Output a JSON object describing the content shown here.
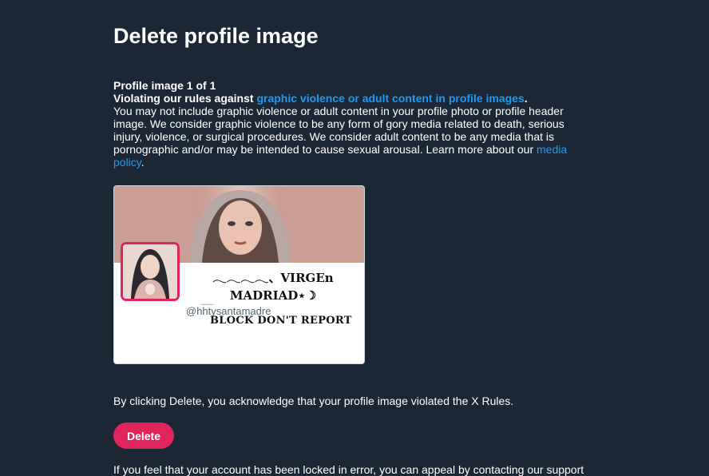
{
  "page": {
    "title": "Delete profile image",
    "count_label": "Profile image 1 of 1"
  },
  "rule": {
    "prefix": "Violating our rules against ",
    "link": "graphic violence or adult content in profile images",
    "suffix": ".",
    "description": "You may not include graphic violence or adult content in your profile photo or profile header image. We consider graphic violence to be any form of gory media related to death, serious injury, violence, or surgical procedures. We consider adult content to be any media that is pornographic and/or may be intended to cause sexual arousal. Learn more about our ",
    "policy_link": "media policy",
    "policy_suffix": "."
  },
  "profile_card": {
    "display_name_line1": "𓂃𓂃𓂃𓂃、VIRGEn",
    "display_name_line2": "MADRIAD⋆☽",
    "handle": "@hhtysantamadre",
    "bio": "BLOCK DON'T REPORT"
  },
  "acknowledgement": "By clicking Delete, you acknowledge that your profile image violated the X Rules.",
  "delete_button": "Delete",
  "appeal_text": "If you feel that your account has been locked in error, you can appeal by contacting our support",
  "colors": {
    "background": "#1b2735",
    "link": "#1d9bf0",
    "delete_button": "#e0245e",
    "avatar_border": "#e0245e"
  }
}
